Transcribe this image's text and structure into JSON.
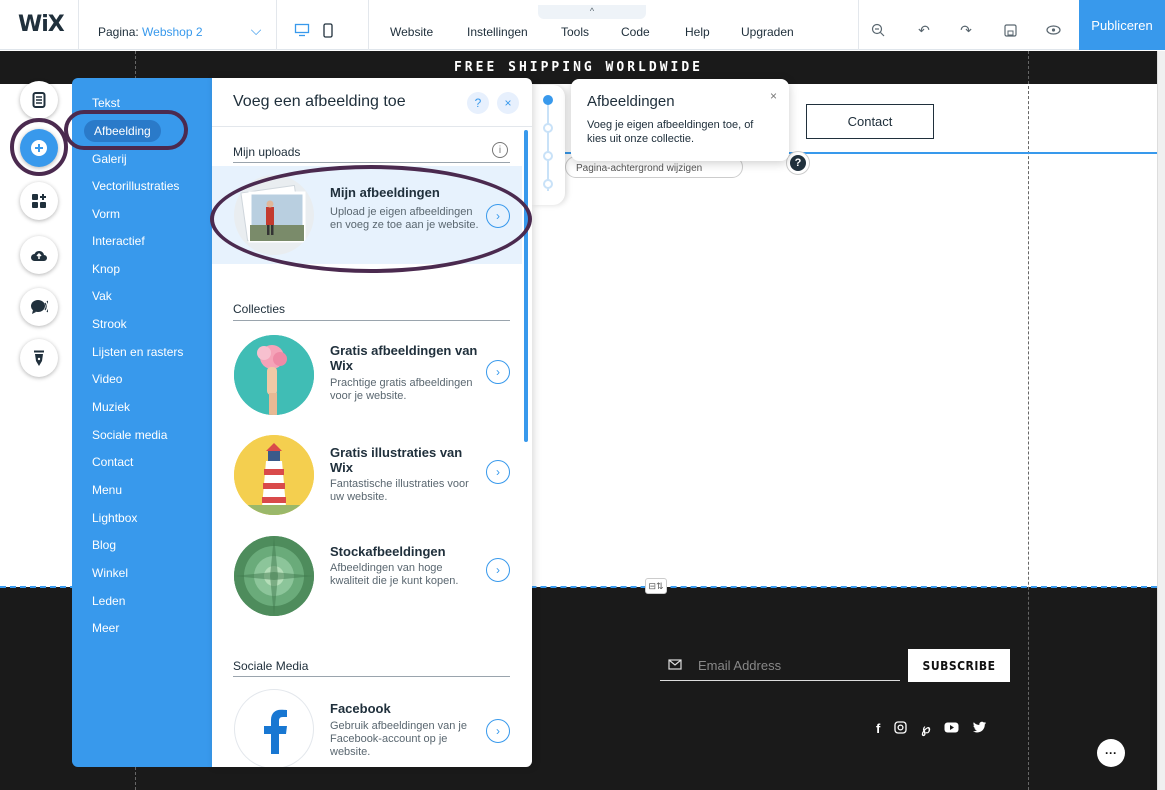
{
  "topbar": {
    "logo": "WiX",
    "page_label": "Pagina:",
    "page_value": "Webshop 2",
    "tools_tab": "^",
    "menu": [
      "Website",
      "Instellingen",
      "Tools",
      "Code",
      "Help",
      "Upgraden"
    ],
    "publish": "Publiceren"
  },
  "site": {
    "banner": "FREE SHIPPING WORLDWIDE",
    "contact_button": "Contact",
    "bg_chip": "Pagina-achtergrond wijzigen",
    "email_placeholder": "Email Address",
    "subscribe": "SUBSCRIBE",
    "strip_handle": "⊟⇅"
  },
  "tooltip": {
    "title": "Afbeeldingen",
    "text": "Voeg je eigen afbeeldingen toe, of kies uit onze collectie."
  },
  "categories": [
    "Tekst",
    "Afbeelding",
    "Galerij",
    "Vectorillustraties",
    "Vorm",
    "Interactief",
    "Knop",
    "Vak",
    "Strook",
    "Lijsten en rasters",
    "Video",
    "Muziek",
    "Sociale media",
    "Contact",
    "Menu",
    "Lightbox",
    "Blog",
    "Winkel",
    "Leden",
    "Meer"
  ],
  "panel": {
    "title": "Voeg een afbeelding toe",
    "help": "?",
    "close": "×",
    "sections": {
      "uploads": "Mijn uploads",
      "collections": "Collecties",
      "social": "Sociale Media"
    },
    "items": [
      {
        "title": "Mijn afbeeldingen",
        "desc": "Upload je eigen afbeeldingen en voeg ze toe aan je website."
      },
      {
        "title": "Gratis afbeeldingen van Wix",
        "desc": "Prachtige gratis afbeeldingen voor je website."
      },
      {
        "title": "Gratis illustraties van Wix",
        "desc": "Fantastische illustraties voor uw website."
      },
      {
        "title": "Stockafbeeldingen",
        "desc": "Afbeeldingen van hoge kwaliteit die je kunt kopen."
      },
      {
        "title": "Facebook",
        "desc": "Gebruik afbeeldingen van je Facebook-account op je website."
      }
    ]
  },
  "colors": {
    "accent": "#3899ec",
    "dark": "#1a1a1a",
    "annotation": "#4b2a4f"
  }
}
